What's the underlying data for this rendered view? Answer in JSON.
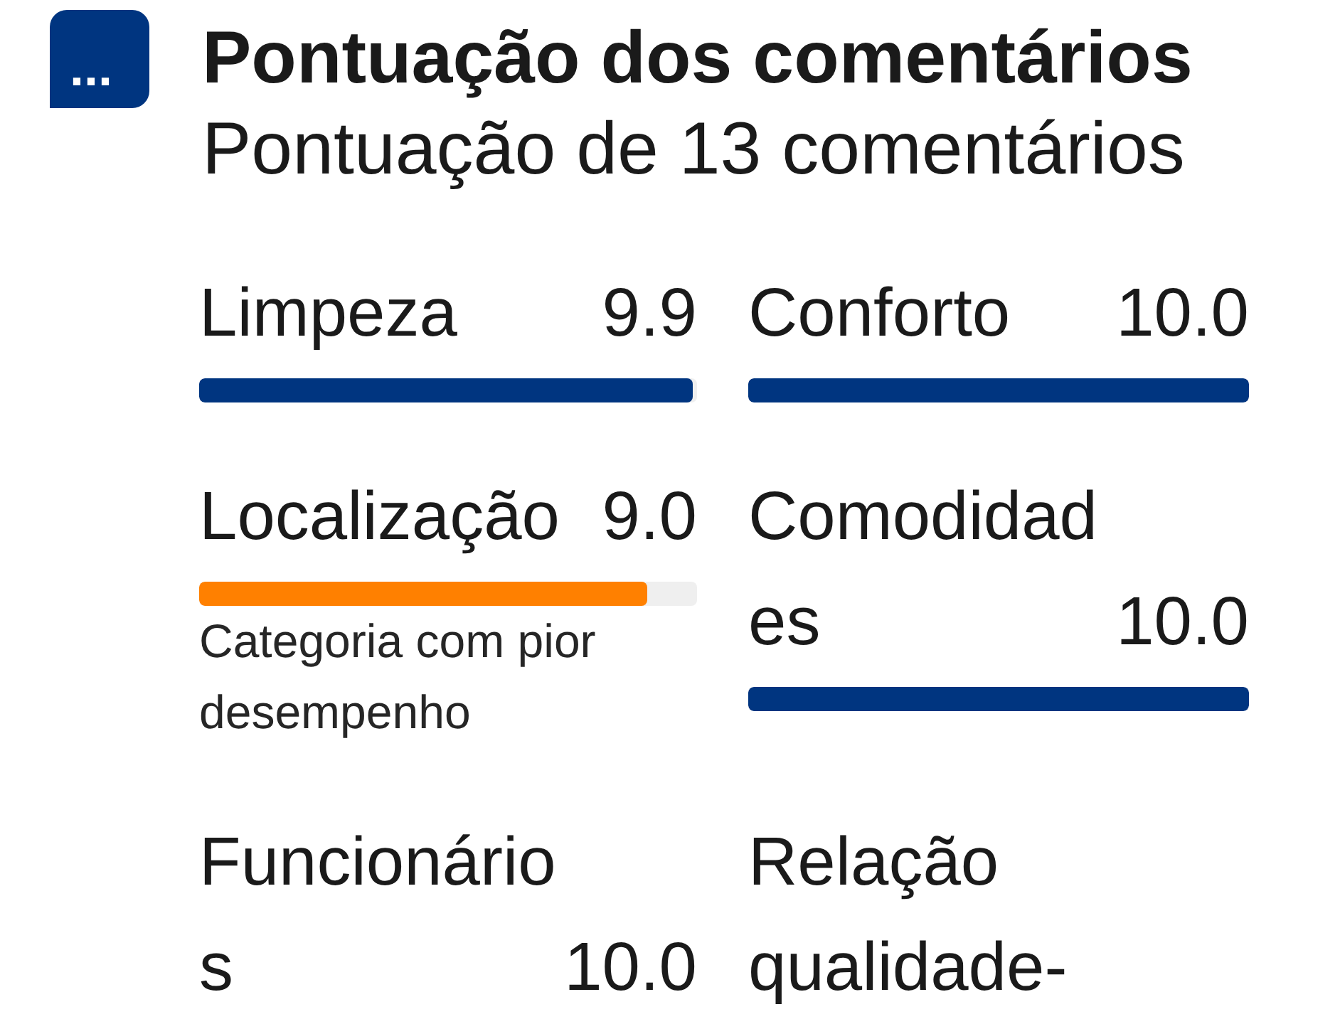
{
  "badge": {
    "text": "..."
  },
  "title": "Pontuação dos comentários",
  "subtitle": "Pontuação de 13 comentários",
  "categories": [
    {
      "name": "Limpeza",
      "score": "9.9",
      "level": 0.99,
      "color": "#003580"
    },
    {
      "name": "Conforto",
      "score": "10.0",
      "level": 1,
      "color": "#003580"
    },
    {
      "name": "Localização",
      "score": "9.0",
      "level": 0.9,
      "color": "#ff8000",
      "note": "Categoria com pior desempenho"
    },
    {
      "name": "Comodidades",
      "score": "10.0",
      "level": 1,
      "color": "#003580"
    },
    {
      "name": "Funcionários",
      "score": "10.0"
    },
    {
      "name": "Relação qualidade-"
    }
  ]
}
